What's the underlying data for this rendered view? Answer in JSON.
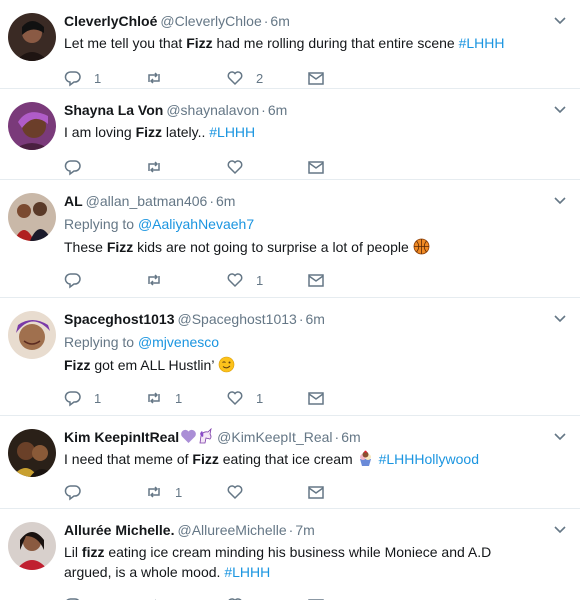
{
  "tweets": [
    {
      "display_name": "CleverlyChloé",
      "handle": "@CleverlyChloe",
      "dot": "·",
      "time": "6m",
      "reply_label": "",
      "reply_to": "",
      "text_1": "Let me tell you that ",
      "keyword": "Fizz",
      "text_2": " had me rolling during that entire scene ",
      "hashtag": "#LHHH",
      "replies": "1",
      "retweets": "",
      "likes": "2"
    },
    {
      "display_name": "Shayna La Von",
      "handle": "@shaynalavon",
      "dot": "·",
      "time": "6m",
      "reply_label": "",
      "reply_to": "",
      "text_1": "I am loving ",
      "keyword": "Fizz",
      "text_2": " lately.. ",
      "hashtag": "#LHHH",
      "replies": "",
      "retweets": "",
      "likes": ""
    },
    {
      "display_name": "AL",
      "handle": "@allan_batman406",
      "dot": "·",
      "time": "6m",
      "reply_label": "Replying to ",
      "reply_to": "@AaliyahNevaeh7",
      "text_1": "These ",
      "keyword": "Fizz",
      "text_2": " kids are not going to surprise a lot of people ",
      "hashtag": "",
      "emoji": "basketball-emoji",
      "replies": "",
      "retweets": "",
      "likes": "1"
    },
    {
      "display_name": "Spaceghost1013",
      "handle": "@Spaceghost1013",
      "dot": "·",
      "time": "6m",
      "reply_label": "Replying to ",
      "reply_to": "@mjvenesco",
      "text_1": "",
      "keyword": "Fizz",
      "text_2": " got em ALL Hustlin’ ",
      "hashtag": "",
      "emoji": "winking-face-emoji",
      "replies": "1",
      "retweets": "1",
      "likes": "1"
    },
    {
      "display_name": "Kim KeepinItReal",
      "handle": "@KimKeepIt_Real",
      "dot": "·",
      "time": "6m",
      "reply_label": "",
      "reply_to": "",
      "text_1": "I need that meme of ",
      "keyword": "Fizz",
      "text_2": " eating that ice cream ",
      "hashtag": "#LHHHollywood",
      "emoji": "ice-cream-emoji",
      "name_emojis": [
        "purple-heart-emoji",
        "unicorn-emoji"
      ],
      "replies": "",
      "retweets": "1",
      "likes": ""
    },
    {
      "display_name": "Allurée Michelle.",
      "handle": "@AllureeMichelle",
      "dot": "·",
      "time": "7m",
      "reply_label": "",
      "reply_to": "",
      "text_1": "Lil ",
      "keyword": "fizz",
      "text_2": " eating ice cream minding his business while Moniece and A.D argued, is a whole mood. ",
      "hashtag": "#LHHH",
      "replies": "",
      "retweets": "",
      "likes": ""
    }
  ],
  "colors": {
    "link": "#1b95e0",
    "muted": "#657786",
    "text": "#14171a",
    "divider": "#e6ecf0"
  },
  "icons": {
    "reply": "reply-icon",
    "retweet": "retweet-icon",
    "like": "heart-icon",
    "dm": "envelope-icon",
    "menu": "chevron-down-icon"
  }
}
